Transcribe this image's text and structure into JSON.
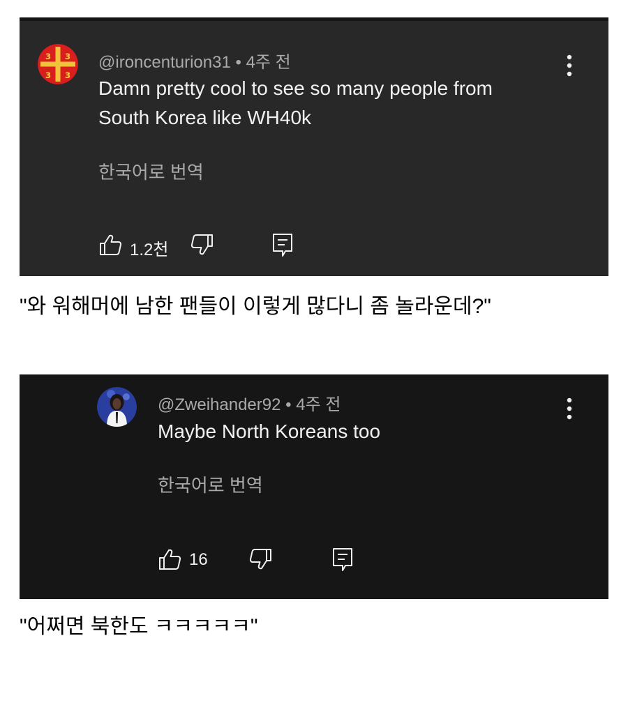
{
  "comments": [
    {
      "username": "@ironcenturion31",
      "age": "4주 전",
      "text_line1": "Damn pretty cool to see so many people from",
      "text_line2": "South Korea like WH40k",
      "translate": "한국어로 번역",
      "likes": "1.2천",
      "avatar_icon": "byzantine-flag-avatar",
      "avatar_colors": {
        "background": "#d91e1e",
        "cross": "#f3c23b"
      }
    },
    {
      "username": "@Zweihander92",
      "age": "4주 전",
      "text": "Maybe North Koreans too",
      "translate": "한국어로 번역",
      "likes": "16",
      "avatar_icon": "person-photo-avatar"
    }
  ],
  "captions": {
    "first": "\"와 워해머에 남한 팬들이 이렇게 많다니 좀 놀라운데?\"",
    "second": "\"어쩌면 북한도 ㅋㅋㅋㅋㅋ\""
  },
  "colors": {
    "panel1_bg": "#282828",
    "panel2_bg": "#161616",
    "primary_text": "#f1f1f1",
    "secondary_text": "#aaaaaa"
  }
}
